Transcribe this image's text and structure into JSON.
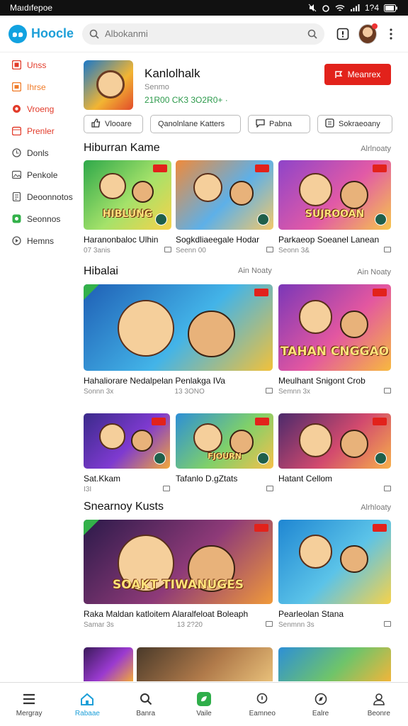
{
  "status": {
    "time": "Maıdıfepoe",
    "right_text": "1?4",
    "icons": [
      "sim-icon",
      "mute-icon",
      "alarm-icon",
      "wifi-icon",
      "signal-icon",
      "battery-icon"
    ]
  },
  "app": {
    "logo_mark": "๑๑",
    "name": "Hoocle"
  },
  "search": {
    "placeholder": "Albokanmi"
  },
  "sidebar": {
    "items": [
      {
        "label": "Unss",
        "color": "#e23b2a",
        "icon": "grid-icon"
      },
      {
        "label": "Ihrse",
        "color": "#f07c2a",
        "icon": "square-icon"
      },
      {
        "label": "Vroeng",
        "color": "#e23b2a",
        "icon": "flower-icon"
      },
      {
        "label": "Prenler",
        "color": "#e23b2a",
        "icon": "calendar-icon"
      },
      {
        "label": "Donls",
        "color": "#555555",
        "icon": "clock-icon"
      },
      {
        "label": "Penkole",
        "color": "#555555",
        "icon": "gallery-icon"
      },
      {
        "label": "Deoonnotos",
        "color": "#555555",
        "icon": "document-icon"
      },
      {
        "label": "Seonnos",
        "color": "#33b14a",
        "icon": "puzzle-icon"
      },
      {
        "label": "Hemns",
        "color": "#555555",
        "icon": "play-icon"
      }
    ]
  },
  "featured": {
    "title": "Kanlolhalk",
    "subtitle": "Senmo",
    "meta": "21R00 CK3 3O2R0+ ·",
    "cta": "Meanrex"
  },
  "chips": [
    {
      "label": "Vlooare",
      "icon": "thumb-icon"
    },
    {
      "label": "Qanolnlane Katters",
      "icon": ""
    },
    {
      "label": "Pabna",
      "icon": "chat-icon"
    },
    {
      "label": "Sokraeoany",
      "icon": "box-icon"
    }
  ],
  "sections": [
    {
      "title": "Hiburran Kame",
      "more": "Alrlnoaty",
      "cards": [
        {
          "name": "Haranonbaloc Ulhin",
          "meta": "07 3anis",
          "grad": [
            "#2ea84a",
            "#a5e26a",
            "#f7d24a"
          ],
          "corner": false,
          "check": true,
          "art": "HIBLUNG"
        },
        {
          "name": "Sogkdliaeegale Hodar",
          "meta": "Seenn 00",
          "grad": [
            "#f08a3a",
            "#5db0e8",
            "#f3c86a"
          ],
          "corner": false,
          "check": true,
          "art": ""
        },
        {
          "name": "Parkaeop Soeanel Lanean",
          "meta": "Seonn 3&",
          "grad": [
            "#8e44c9",
            "#e25aa6",
            "#f6c64b"
          ],
          "corner": false,
          "check": true,
          "art": "SUJROOAN"
        }
      ]
    },
    {
      "title": "Hibalai",
      "more": "Ain Noaty",
      "more2": "Ain Noaty",
      "cards": [
        {
          "name": "Hahaliorare Nedalpelan Penlakga IVa",
          "meta": "Sonnn 3x",
          "meta2": "13 3ONO",
          "grad": [
            "#1f5fb5",
            "#43b4e8",
            "#f2c13a"
          ],
          "corner": true,
          "check": false,
          "art": ""
        },
        {
          "name": "Meulhant Snigont Crob",
          "meta": "Semnn 3x",
          "grad": [
            "#7a37b8",
            "#e357a0",
            "#f7b93f"
          ],
          "corner": false,
          "check": false,
          "art": "TAHAN CNGGAO"
        }
      ]
    },
    {
      "title": "",
      "more": "",
      "cards": [
        {
          "name": "Sat.Kkam",
          "meta": "I3I",
          "grad": [
            "#3a2a8a",
            "#7e3ad0",
            "#f2a83a"
          ],
          "corner": false,
          "check": true,
          "art": ""
        },
        {
          "name": "Tafanlo D.gZtats",
          "meta": "",
          "grad": [
            "#2d8fd6",
            "#7fd06a",
            "#f6c04a"
          ],
          "corner": false,
          "check": true,
          "art": "FJOURN"
        },
        {
          "name": "Hatant Cellom",
          "meta": "",
          "grad": [
            "#4b2a6b",
            "#d24a6e",
            "#f7b04a"
          ],
          "corner": false,
          "check": true,
          "art": ""
        }
      ]
    },
    {
      "title": "Snearnoy Kusts",
      "more": "Alrhloaty",
      "cards": [
        {
          "name": "Raka Maldan katloitem Alaralfeloat Boleaph",
          "meta": "Samar 3s",
          "meta2": "13 2?20",
          "grad": [
            "#2b1a4a",
            "#8e3a78",
            "#f09a3a"
          ],
          "corner": true,
          "check": false,
          "art": "SOAKT TIWANUGES"
        },
        {
          "name": "Pearleolan Stana",
          "meta": "Senmnn 3s",
          "grad": [
            "#1f86d2",
            "#5bc3e8",
            "#f6d24a"
          ],
          "corner": false,
          "check": false,
          "art": ""
        }
      ]
    }
  ],
  "bottom_tabs": [
    {
      "label": "Mergray",
      "icon": "menu-icon",
      "active": false
    },
    {
      "label": "Rabaae",
      "icon": "home-icon",
      "active": true
    },
    {
      "label": "Banra",
      "icon": "search-icon",
      "active": false
    },
    {
      "label": "Vaile",
      "icon": "leaf-icon",
      "active": false
    },
    {
      "label": "Eamneo",
      "icon": "bulb-icon",
      "active": false
    },
    {
      "label": "Ealre",
      "icon": "compass-icon",
      "active": false
    },
    {
      "label": "Beonre",
      "icon": "user-icon",
      "active": false
    }
  ]
}
